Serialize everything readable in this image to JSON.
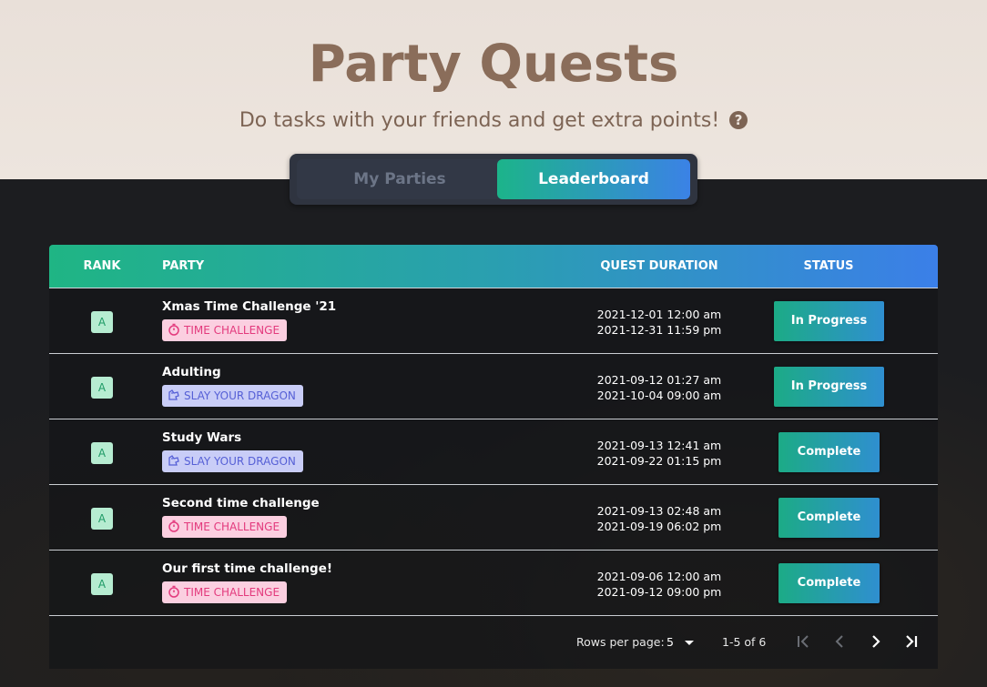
{
  "header": {
    "title": "Party Quests",
    "subtitle": "Do tasks with your friends and get extra points!",
    "help_icon": "?"
  },
  "tabs": [
    {
      "label": "My Parties",
      "active": false
    },
    {
      "label": "Leaderboard",
      "active": true
    }
  ],
  "table": {
    "columns": {
      "rank": "RANK",
      "party": "PARTY",
      "duration": "QUEST DURATION",
      "status": "STATUS"
    },
    "rows": [
      {
        "rank": "A",
        "name": "Xmas Time Challenge '21",
        "tag": "TIME CHALLENGE",
        "tag_icon": "stopwatch-icon",
        "start": "2021-12-01 12:00 am",
        "end": "2021-12-31 11:59 pm",
        "status": "In Progress"
      },
      {
        "rank": "A",
        "name": "Adulting",
        "tag": "SLAY YOUR DRAGON",
        "tag_icon": "dragon-icon",
        "start": "2021-09-12 01:27 am",
        "end": "2021-10-04 09:00 am",
        "status": "In Progress"
      },
      {
        "rank": "A",
        "name": "Study Wars",
        "tag": "SLAY YOUR DRAGON",
        "tag_icon": "dragon-icon",
        "start": "2021-09-13 12:41 am",
        "end": "2021-09-22 01:15 pm",
        "status": "Complete"
      },
      {
        "rank": "A",
        "name": "Second time challenge",
        "tag": "TIME CHALLENGE",
        "tag_icon": "stopwatch-icon",
        "start": "2021-09-13 02:48 am",
        "end": "2021-09-19 06:02 pm",
        "status": "Complete"
      },
      {
        "rank": "A",
        "name": "Our first time challenge!",
        "tag": "TIME CHALLENGE",
        "tag_icon": "stopwatch-icon",
        "start": "2021-09-06 12:00 am",
        "end": "2021-09-12 09:00 pm",
        "status": "Complete"
      }
    ]
  },
  "pagination": {
    "rows_per_page_label": "Rows per page:",
    "rows_per_page": "5",
    "range": "1-5 of 6"
  },
  "colors": {
    "title": "#8a6d5a",
    "accent_start": "#1cb48a",
    "accent_end": "#3b82e6",
    "time_tag_bg": "#fbcfe0",
    "time_tag_text": "#e33a7d",
    "dragon_tag_bg": "#c9cdf7",
    "dragon_tag_text": "#5660d6",
    "rank_badge_bg": "#b6ecd1"
  }
}
